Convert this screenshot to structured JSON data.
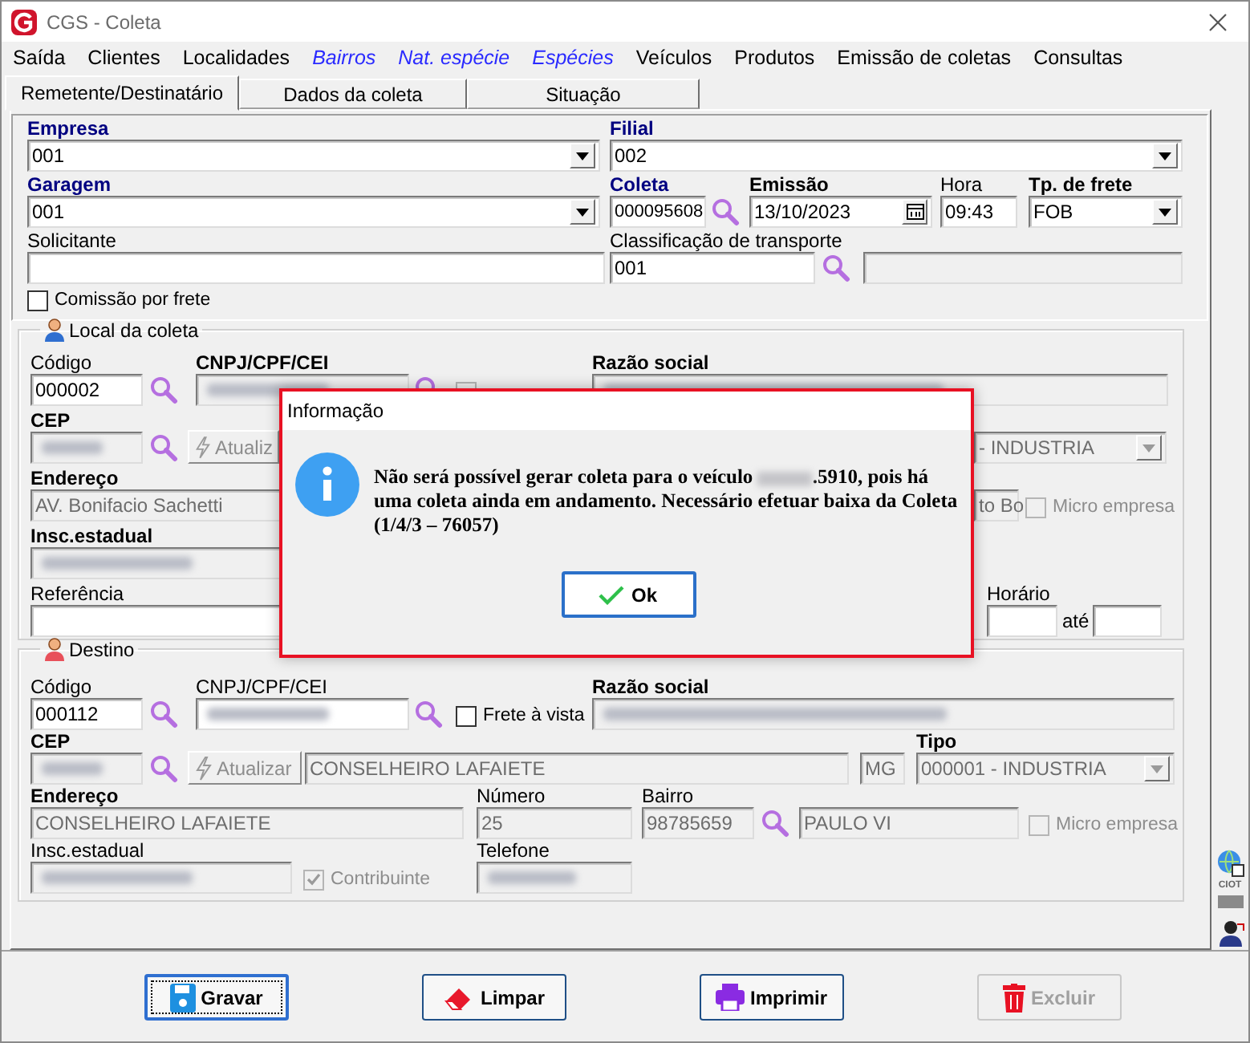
{
  "window": {
    "title": "CGS - Coleta"
  },
  "menu": [
    {
      "label": "Saída",
      "kind": "plain"
    },
    {
      "label": "Clientes",
      "kind": "plain"
    },
    {
      "label": "Localidades",
      "kind": "plain"
    },
    {
      "label": "Bairros",
      "kind": "link"
    },
    {
      "label": "Nat. espécie",
      "kind": "link"
    },
    {
      "label": "Espécies",
      "kind": "link"
    },
    {
      "label": "Veículos",
      "kind": "plain"
    },
    {
      "label": "Produtos",
      "kind": "plain"
    },
    {
      "label": "Emissão de coletas",
      "kind": "plain"
    },
    {
      "label": "Consultas",
      "kind": "plain"
    }
  ],
  "tabs": [
    {
      "label": "Remetente/Destinatário",
      "selected": true
    },
    {
      "label": "Dados da coleta",
      "selected": false
    },
    {
      "label": "Situação",
      "selected": false
    }
  ],
  "header": {
    "empresa": {
      "label": "Empresa",
      "required": true,
      "bold": true,
      "value": "001"
    },
    "filial": {
      "label": "Filial",
      "required": true,
      "bold": true,
      "value": "002"
    },
    "garagem": {
      "label": "Garagem",
      "required": true,
      "bold": true,
      "value": "001"
    },
    "coleta": {
      "label": "Coleta",
      "required": true,
      "bold": true,
      "value": "000095608"
    },
    "emissao": {
      "label": "Emissão",
      "required": false,
      "bold": true,
      "value": "13/10/2023"
    },
    "hora": {
      "label": "Hora",
      "required": false,
      "bold": false,
      "value": "09:43"
    },
    "tp_frete": {
      "label": "Tp. de frete",
      "required": false,
      "bold": true,
      "value": "FOB"
    },
    "solicitante": {
      "label": "Solicitante",
      "required": false,
      "bold": false
    },
    "classificacao": {
      "label": "Classificação de transporte",
      "required": false,
      "bold": false,
      "value": "001"
    },
    "classificacao_desc": {
      "disabled": true
    },
    "comissao": {
      "label": "Comissão por frete",
      "checked": false,
      "disabled": false
    }
  },
  "local_coleta": {
    "title": "Local da coleta",
    "codigo": {
      "label": "Código",
      "required": false,
      "bold": false,
      "value": "000002"
    },
    "cnpj": {
      "label": "CNPJ/CPF/CEI",
      "required": false,
      "bold": true,
      "disabled": true,
      "redacted": true
    },
    "frete": {
      "checked": false,
      "disabled": true
    },
    "razao": {
      "label": "Razão social",
      "required": false,
      "bold": true,
      "disabled": true,
      "redacted": true
    },
    "cep": {
      "label": "CEP",
      "required": false,
      "bold": true,
      "disabled": true,
      "redacted": true
    },
    "atualizar": {
      "label": "Atualiz",
      "disabled": true
    },
    "tipo": {
      "value": "- INDUSTRIA",
      "disabled": true
    },
    "endereco": {
      "label": "Endereço",
      "required": false,
      "bold": true,
      "value": "AV. Bonifacio Sachetti",
      "disabled": true
    },
    "bairro_nome": {
      "value": "to Bo",
      "disabled": true
    },
    "micro": {
      "label": "Micro empresa",
      "checked": false,
      "disabled": true
    },
    "insc": {
      "label": "Insc.estadual",
      "required": false,
      "bold": true,
      "disabled": true,
      "redacted": true
    },
    "referencia": {
      "label": "Referência",
      "required": false,
      "bold": false
    },
    "horario": {
      "label": "Horário",
      "required": false,
      "bold": false
    },
    "ate": {
      "label": "até"
    },
    "horario_fim": {
      "disabled": false
    }
  },
  "destino": {
    "title": "Destino",
    "codigo": {
      "label": "Código",
      "required": false,
      "bold": false,
      "value": "000112"
    },
    "cnpj": {
      "label": "CNPJ/CPF/CEI",
      "required": false,
      "bold": false,
      "disabled": false,
      "redacted": true
    },
    "frete": {
      "label": "Frete à vista",
      "checked": false,
      "disabled": false
    },
    "razao": {
      "label": "Razão social",
      "required": false,
      "bold": true,
      "disabled": true,
      "redacted": true
    },
    "cep": {
      "label": "CEP",
      "required": false,
      "bold": true,
      "disabled": true,
      "redacted": true
    },
    "atualizar": {
      "label": "Atualizar",
      "disabled": true
    },
    "cidade": {
      "value": "CONSELHEIRO LAFAIETE",
      "disabled": true
    },
    "uf": {
      "value": "MG",
      "disabled": true
    },
    "tipo": {
      "label": "Tipo",
      "required": false,
      "bold": true,
      "value": "000001 - INDUSTRIA",
      "disabled": true
    },
    "endereco": {
      "label": "Endereço",
      "required": false,
      "bold": true,
      "value": "CONSELHEIRO LAFAIETE",
      "disabled": true
    },
    "numero": {
      "label": "Número",
      "required": false,
      "bold": false,
      "value": "25",
      "disabled": true
    },
    "bairro": {
      "label": "Bairro",
      "required": false,
      "bold": false,
      "value": "98785659",
      "disabled": true
    },
    "bairro_nome": {
      "value": "PAULO VI",
      "disabled": true
    },
    "micro": {
      "label": "Micro empresa",
      "checked": false,
      "disabled": true
    },
    "insc": {
      "label": "Insc.estadual",
      "required": false,
      "bold": false,
      "disabled": true,
      "redacted": true
    },
    "contribuinte": {
      "label": "Contribuinte",
      "checked": true,
      "disabled": true
    },
    "telefone": {
      "label": "Telefone",
      "required": false,
      "bold": false,
      "disabled": true,
      "redacted": true
    }
  },
  "side_tools": {
    "ciot": "CIOT"
  },
  "buttons": [
    {
      "label": "Gravar",
      "kind": "save",
      "focused": true,
      "disabled": false
    },
    {
      "label": "Limpar",
      "kind": "clear",
      "focused": false,
      "disabled": false
    },
    {
      "label": "Imprimir",
      "kind": "print",
      "focused": false,
      "disabled": false
    },
    {
      "label": "Excluir",
      "kind": "delete",
      "focused": false,
      "disabled": true
    }
  ],
  "dialog": {
    "title": "Informação",
    "message_before": "Não será possível gerar coleta para o veículo",
    "message_after": ".5910, pois há uma coleta ainda em andamento. Necessário efetuar baixa da Coleta (1/4/3 – 76057)",
    "ok": "Ok"
  }
}
